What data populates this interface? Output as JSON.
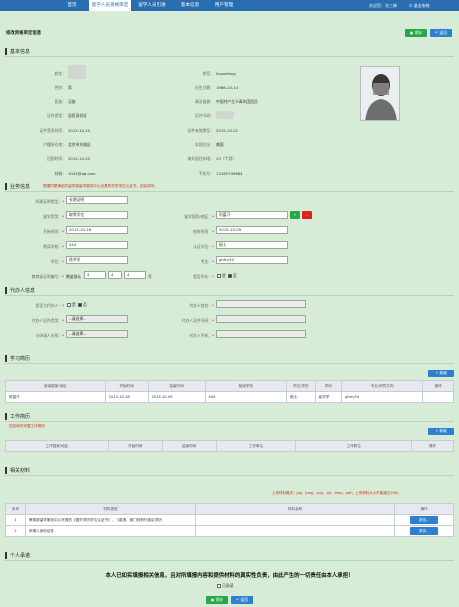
{
  "nav": {
    "items": [
      "首页",
      "留学人员资格审定",
      "留学人员引进",
      "基本信息",
      "用户管理"
    ],
    "welcome": "欢迎您：张三峰",
    "logout": "退出系统"
  },
  "page": {
    "title": "修改资格审定信息",
    "save_label": "保存",
    "back_label": "返回"
  },
  "basic": {
    "section_title": "基本信息",
    "left_labels": [
      "姓名：",
      "性别：",
      "民族：",
      "证件类型：",
      "证件签发时间：",
      "户籍所在地：",
      "回国时间：",
      "邮箱："
    ],
    "left_values": [
      "",
      "男",
      "汉族",
      "居民身份证",
      "2013-10-10",
      "北京市东城区",
      "2015-10-22",
      "1024@qq.com"
    ],
    "right_labels": [
      "拼音：",
      "出生日期：",
      "政治面貌：",
      "证件号码：",
      "证件有效期至：",
      "本国住址：",
      "海外居住年限：",
      "手机号："
    ],
    "right_values": [
      "liusanfeng",
      "1986-10-14",
      "中国共产主义青年团团员",
      "",
      "2015-10-22",
      "美国",
      "23（个月）",
      "13185749664"
    ]
  },
  "business": {
    "section_title": "业务信息",
    "note": "根据内蒙满足的留学部留学服务中心出具的学历学位认证书，如实填写。",
    "labels": {
      "study_type": "所需证明类型：",
      "study_mode": "留学类型：",
      "start": "开始时间：",
      "school": "就读学校：",
      "degree": "学位：",
      "years": "教育留证明编号：",
      "country": "留学国别/地区：",
      "end": "结束时间：",
      "cert_school": "认证学位：",
      "major": "专业：",
      "graduate": "是否毕业："
    },
    "values": {
      "study_type": "长期证明",
      "study_mode": "取得学位",
      "start": "2013-10-18",
      "school": "544",
      "degree": "经济学",
      "years_prefix": "教留部认",
      "years_a": "4",
      "years_b": "4",
      "years_c": "4",
      "years_suffix": "号",
      "country": "阿富汗",
      "end": "2015-10-09",
      "cert_school": "硕士",
      "major": "ghtry54",
      "graduate_yes": "是",
      "graduate_no": "否"
    },
    "plus": "+",
    "minus": "-"
  },
  "agent": {
    "section_title": "代办人信息",
    "labels": {
      "is_agent": "是否为代办人：",
      "cert_type": "代办人证件类型：",
      "relation": "与申请人关系：",
      "name": "代办人姓名：",
      "cert_no": "代办人证件号码：",
      "phone": "代办人手机："
    },
    "yes": "是",
    "no": "否",
    "select_placeholder": "--请选择--"
  },
  "study": {
    "section_title": "学习简历",
    "add_label": "新增",
    "headers": [
      "就读国家/地区",
      "开始时间",
      "结束时间",
      "就读学校",
      "学位/学历",
      "学科",
      "专业/研究方向",
      "操作"
    ],
    "rows": [
      [
        "阿富汗",
        "2013-10-18",
        "2015-10-09",
        "544",
        "硕士",
        "经济学",
        "ghtry54",
        ""
      ]
    ]
  },
  "work": {
    "section_title": "工作简历",
    "note": "如实填写完整工作简历",
    "add_label": "新增",
    "headers": [
      "工作国家/地区",
      "开始时间",
      "结束时间",
      "工作单位",
      "工作职位",
      "操作"
    ]
  },
  "materials": {
    "section_title": "相关材料",
    "note": "上传材料格式：jpg、jpeg、png、gif、bmp、pdf；上传材料大小不能超过10M。",
    "headers": [
      "序号",
      "材料类型",
      "材料名称",
      "操作"
    ],
    "rows": [
      {
        "no": "1",
        "type": "教育部留学服务中心开具的《国外学历学位认证书》、《香港、澳门特别行政区学历",
        "name": "",
        "op": "浏览..."
      },
      {
        "no": "2",
        "type": "申请人身份证件",
        "name": "",
        "op": "浏览..."
      }
    ]
  },
  "promise": {
    "section_title": "个人承诺",
    "text": "本人已如实填报相关信息，且对所填报内容和提供材料的真实性负责，由此产生的一切责任由本人承担！",
    "read_label": "已阅读"
  },
  "footer": {
    "save_label": "保存",
    "back_label": "返回"
  }
}
